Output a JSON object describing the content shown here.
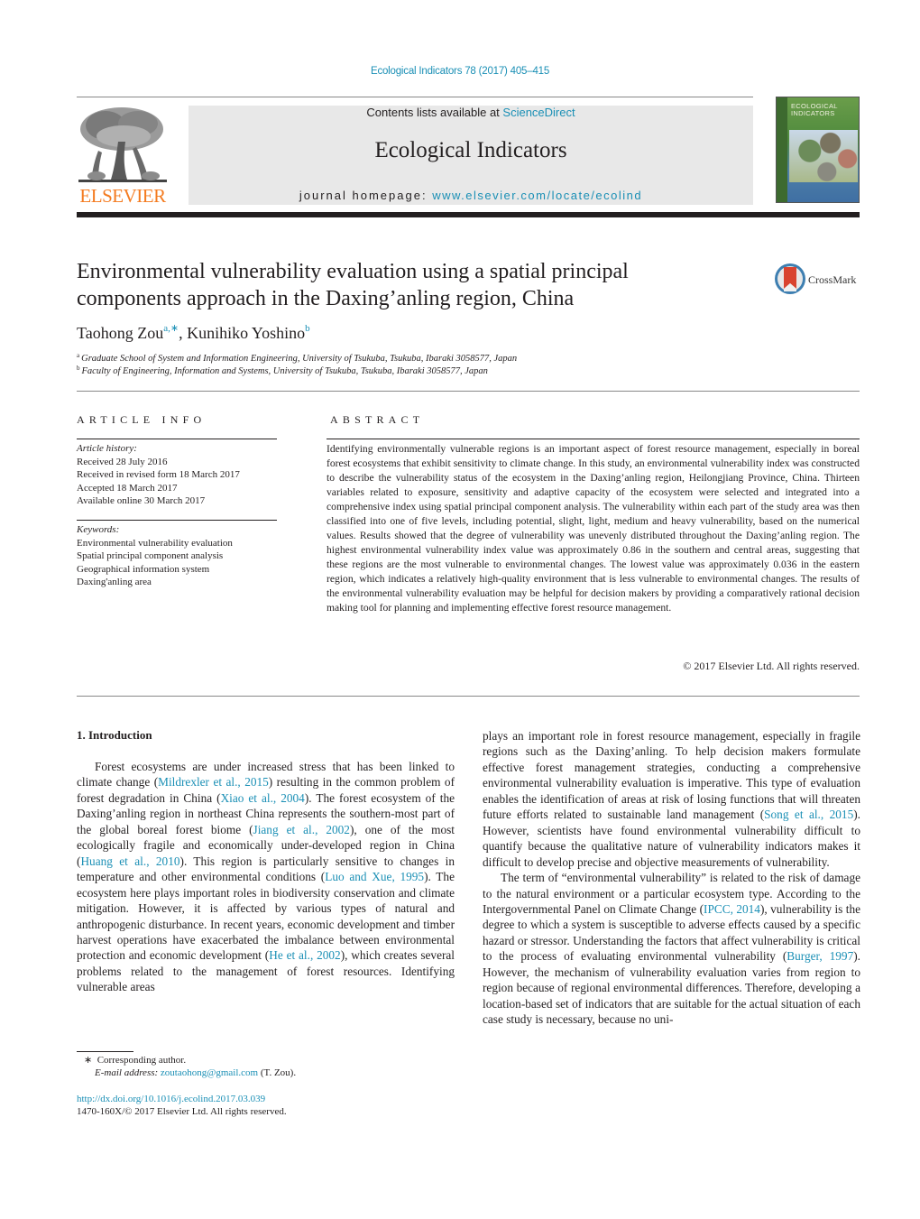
{
  "header": {
    "citation": "Ecological Indicators 78 (2017) 405–415",
    "publisher_logo_text": "ELSEVIER",
    "contents_prefix": "Contents lists available at ",
    "contents_link": "ScienceDirect",
    "journal_name": "Ecological Indicators",
    "homepage_prefix": "journal homepage: ",
    "homepage_link": "www.elsevier.com/locate/ecolind",
    "cover": {
      "title_line1": "ECOLOGICAL",
      "title_line2": "INDICATORS"
    }
  },
  "article": {
    "title": "Environmental vulnerability evaluation using a spatial principal components approach in the Daxing’anling region, China",
    "crossmark_label": "CrossMark",
    "authors": [
      {
        "name": "Taohong Zou",
        "marks": "a,∗"
      },
      {
        "name": "Kunihiko Yoshino",
        "marks": "b"
      }
    ],
    "author_separator": ", ",
    "affiliations": [
      {
        "mark": "a",
        "text": "Graduate School of System and Information Engineering, University of Tsukuba, Tsukuba, Ibaraki 3058577, Japan"
      },
      {
        "mark": "b",
        "text": "Faculty of Engineering, Information and Systems, University of Tsukuba, Tsukuba, Ibaraki 3058577, Japan"
      }
    ]
  },
  "article_info": {
    "heading": "ARTICLE INFO",
    "history_label": "Article history:",
    "history": [
      "Received 28 July 2016",
      "Received in revised form 18 March 2017",
      "Accepted 18 March 2017",
      "Available online 30 March 2017"
    ],
    "keywords_label": "Keywords:",
    "keywords": [
      "Environmental vulnerability evaluation",
      "Spatial principal component analysis",
      "Geographical information system",
      "Daxing'anling area"
    ]
  },
  "abstract": {
    "heading": "ABSTRACT",
    "text": "Identifying environmentally vulnerable regions is an important aspect of forest resource management, especially in boreal forest ecosystems that exhibit sensitivity to climate change. In this study, an envi­ronmental vulnerability index was constructed to describe the vulnerability status of the ecosystem in the Daxing’anling region, Heilongjiang Province, China. Thirteen variables related to exposure, sensitiv­ity and adaptive capacity of the ecosystem were selected and integrated into a comprehensive index using spatial principal component analysis. The vulnerability within each part of the study area was then classified into one of five levels, including potential, slight, light, medium and heavy vulnerability, based on the numerical values. Results showed that the degree of vulnerability was unevenly distributed throughout the Daxing’anling region. The highest environmental vulnerability index value was approx­imately 0.86 in the southern and central areas, suggesting that these regions are the most vulnerable to environmental changes. The lowest value was approximately 0.036 in the eastern region, which indicates a relatively high-quality environment that is less vulnerable to environmental changes. The results of the environmental vulnerability evaluation may be helpful for decision makers by providing a comparatively rational decision making tool for planning and implementing effective forest resource management.",
    "copyright": "© 2017 Elsevier Ltd. All rights reserved."
  },
  "introduction": {
    "heading": "1.  Introduction",
    "left_paragraph": [
      {
        "t": "Forest ecosystems are under increased stress that has been linked to climate change ("
      },
      {
        "l": "Mildrexler et al., 2015"
      },
      {
        "t": ") resulting in the common problem of forest degradation in China ("
      },
      {
        "l": "Xiao et al., 2004"
      },
      {
        "t": "). The forest ecosystem of the Daxing’anling region in northeast China represents the southern-most part of the global boreal forest biome ("
      },
      {
        "l": "Jiang et al., 2002"
      },
      {
        "t": "), one of the most ecologically fragile and eco­nomically under-developed region in China ("
      },
      {
        "l": "Huang et al., 2010"
      },
      {
        "t": "). This region is particularly sensitive to changes in temperature and other environmental conditions ("
      },
      {
        "l": "Luo and Xue, 1995"
      },
      {
        "t": "). The ecosys­tem here plays important roles in biodiversity conservation and climate mitigation. However, it is affected by various types of natural and anthropogenic disturbance. In recent years, economic development and timber harvest operations have exacerbated the imbalance between environmental protection and economic devel­opment ("
      },
      {
        "l": "He et al., 2002"
      },
      {
        "t": "), which creates several problems related to the management of forest resources. Identifying vulnerable areas"
      }
    ],
    "right_paragraph_1": [
      {
        "t": "plays an important role in forest resource management, especially in fragile regions such as the Daxing’anling. To help decision mak­ers formulate effective forest management strategies, conducting a comprehensive environmental vulnerability evaluation is imper­ative. This type of evaluation enables the identification of areas at risk of losing functions that will threaten future efforts related to sustainable land management ("
      },
      {
        "l": "Song et al., 2015"
      },
      {
        "t": "). However, scien­tists have found environmental vulnerability difficult to quantify because the qualitative nature of vulnerability indicators makes it difficult to develop precise and objective measurements of vulner­ability."
      }
    ],
    "right_paragraph_2": [
      {
        "t": "The term of “environmental vulnerability” is related to the risk of damage to the natural environment or a particular ecosystem type. According to the Intergovernmental Panel on Climate Change ("
      },
      {
        "l": "IPCC, 2014"
      },
      {
        "t": "), vulnerability is the degree to which a system is susceptible to adverse effects caused by a specific hazard or stressor. Understand­ing the factors that affect vulnerability is critical to the process of evaluating environmental vulnerability ("
      },
      {
        "l": "Burger, 1997"
      },
      {
        "t": "). However, the mechanism of vulnerability evaluation varies from region to region because of regional environmental differences. Therefore, developing a location-based set of indicators that are suitable for the actual situation of each case study is necessary, because no uni-"
      }
    ]
  },
  "footnotes": {
    "corresponding_mark": "∗",
    "corresponding_text": "Corresponding author.",
    "email_label": "E-mail address:",
    "email": "zoutaohong@gmail.com",
    "email_suffix": " (T. Zou).",
    "doi_link": "http://dx.doi.org/10.1016/j.ecolind.2017.03.039",
    "issn_copyright": "1470-160X/© 2017 Elsevier Ltd. All rights reserved."
  },
  "colors": {
    "link": "#1a8fb5",
    "elsevier_orange": "#f47b20",
    "masthead_bg": "#e8e8e8",
    "text": "#231f20"
  }
}
